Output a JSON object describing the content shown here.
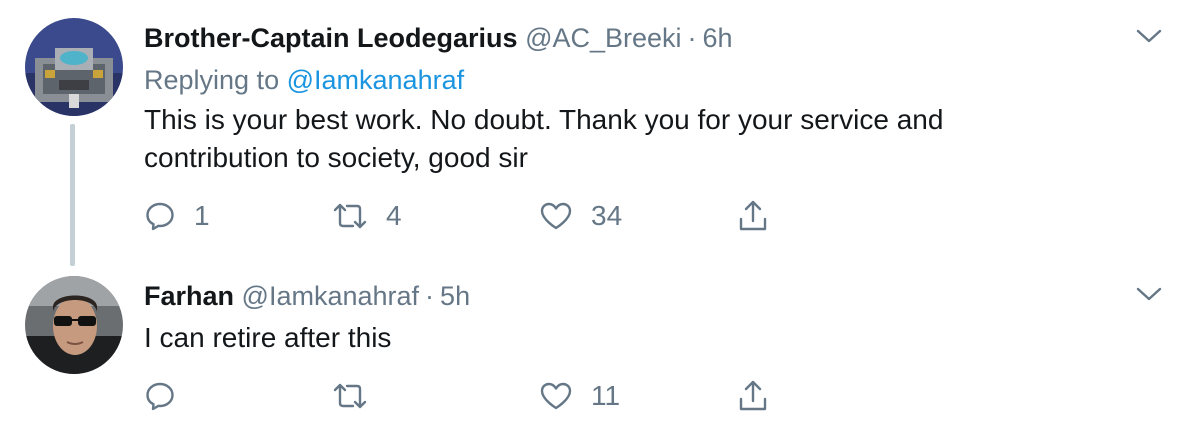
{
  "tweets": [
    {
      "author_name": "Brother-Captain Leodegarius",
      "handle": "@AC_Breeki",
      "separator": "·",
      "time": "6h",
      "replying_label": "Replying to",
      "replying_to": "@Iamkanahraf",
      "text_lines": [
        "This is your best work. No doubt. Thank you for your service and",
        "contribution to society, good sir"
      ],
      "counts": {
        "replies": "1",
        "retweets": "4",
        "likes": "34"
      }
    },
    {
      "author_name": "Farhan",
      "handle": "@Iamkanahraf",
      "separator": "·",
      "time": "5h",
      "text_lines": [
        "I can retire after this"
      ],
      "counts": {
        "replies": "",
        "retweets": "",
        "likes": "11"
      }
    }
  ],
  "colors": {
    "text_primary": "#14171a",
    "text_secondary": "#657786",
    "link": "#1b95e0",
    "thread_line": "#c4cfd6"
  },
  "icons": [
    "reply-icon",
    "retweet-icon",
    "like-icon",
    "share-icon",
    "caret-down-icon"
  ]
}
